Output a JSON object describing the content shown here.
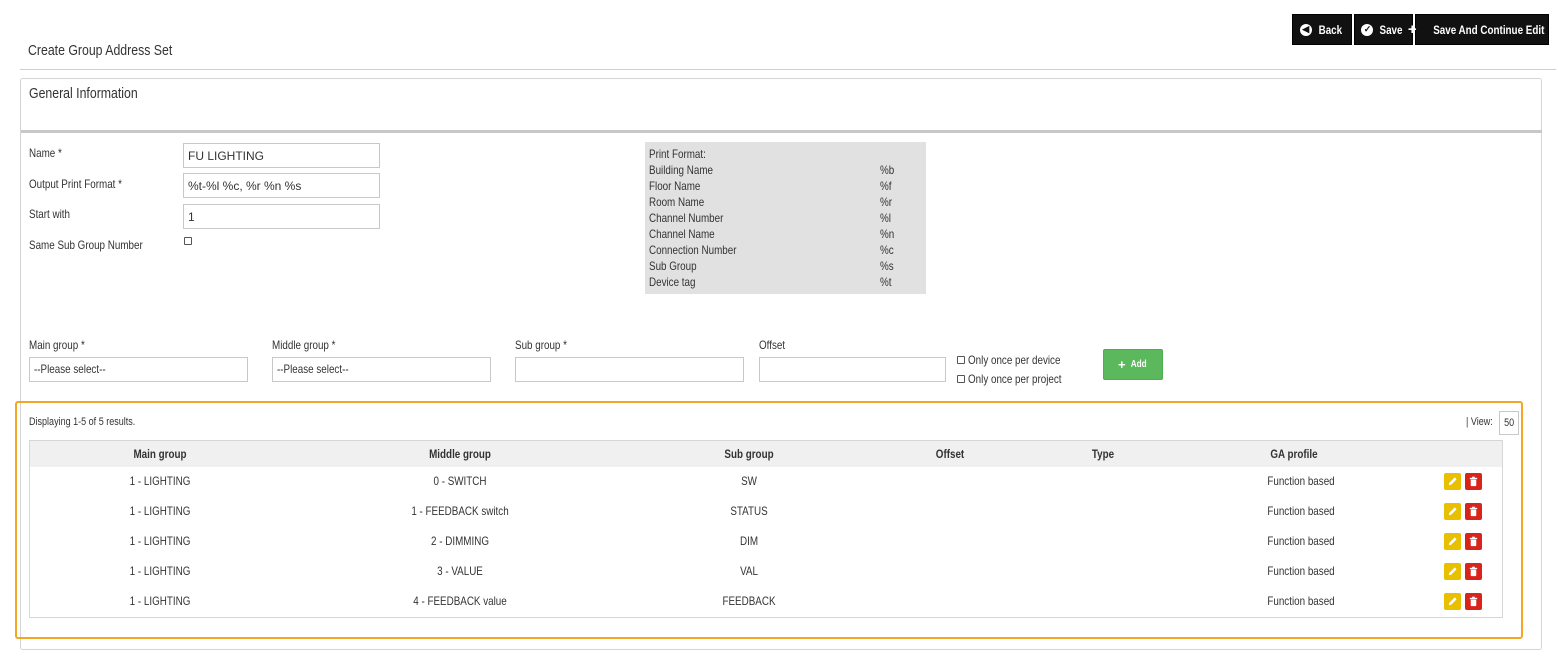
{
  "toolbar": {
    "back_label": "Back",
    "save_label": "Save",
    "save_continue_label": "Save And Continue Edit"
  },
  "page_title": "Create Group Address Set",
  "panel_title": "General Information",
  "form": {
    "name_label": "Name *",
    "name_value": "FU LIGHTING",
    "output_format_label": "Output Print Format *",
    "output_format_value": "%t-%l %c, %r %n %s",
    "start_with_label": "Start with",
    "start_with_value": "1",
    "same_sub_label": "Same Sub Group Number"
  },
  "print_format": {
    "title": "Print Format:",
    "rows": [
      {
        "name": "Building Name",
        "code": "%b"
      },
      {
        "name": "Floor Name",
        "code": "%f"
      },
      {
        "name": "Room Name",
        "code": "%r"
      },
      {
        "name": "Channel Number",
        "code": "%l"
      },
      {
        "name": "Channel Name",
        "code": "%n"
      },
      {
        "name": "Connection Number",
        "code": "%c"
      },
      {
        "name": "Sub Group",
        "code": "%s"
      },
      {
        "name": "Device tag",
        "code": "%t"
      }
    ]
  },
  "address_form": {
    "main_group_label": "Main group *",
    "main_group_value": "--Please select--",
    "middle_group_label": "Middle group *",
    "middle_group_value": "--Please select--",
    "sub_group_label": "Sub group *",
    "offset_label": "Offset",
    "once_device_label": "Only once per device",
    "once_project_label": "Only once per project",
    "add_label": "Add"
  },
  "grid": {
    "summary": "Displaying 1-5 of 5 results.",
    "view_label": "| View:",
    "view_value": "50",
    "columns": [
      "Main group",
      "Middle group",
      "Sub group",
      "Offset",
      "Type",
      "GA profile"
    ],
    "rows": [
      {
        "main": "1 - LIGHTING",
        "middle": "0 - SWITCH",
        "sub": "SW",
        "offset": "",
        "type": "",
        "profile": "Function based"
      },
      {
        "main": "1 - LIGHTING",
        "middle": "1 - FEEDBACK switch",
        "sub": "STATUS",
        "offset": "",
        "type": "",
        "profile": "Function based"
      },
      {
        "main": "1 - LIGHTING",
        "middle": "2 - DIMMING",
        "sub": "DIM",
        "offset": "",
        "type": "",
        "profile": "Function based"
      },
      {
        "main": "1 - LIGHTING",
        "middle": "3 - VALUE",
        "sub": "VAL",
        "offset": "",
        "type": "",
        "profile": "Function based"
      },
      {
        "main": "1 - LIGHTING",
        "middle": "4 - FEEDBACK value",
        "sub": "FEEDBACK",
        "offset": "",
        "type": "",
        "profile": "Function based"
      }
    ]
  }
}
